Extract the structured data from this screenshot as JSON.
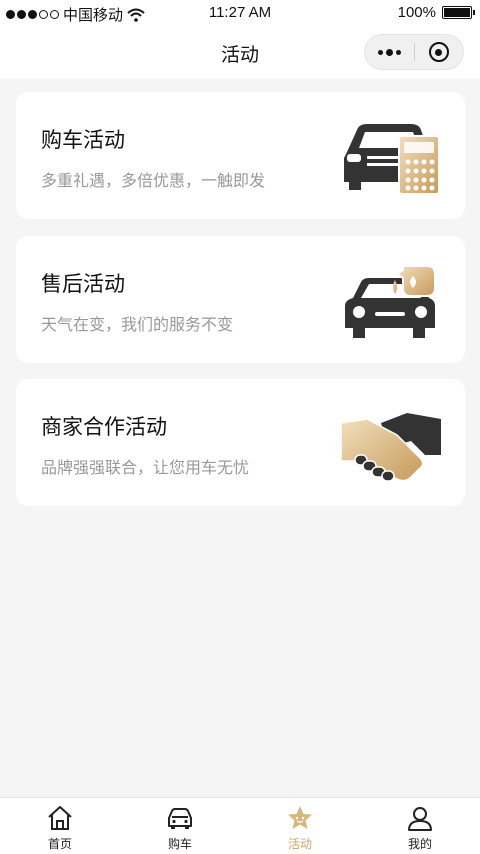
{
  "status_bar": {
    "carrier": "中国移动",
    "time": "11:27 AM",
    "battery": "100%",
    "battery_level": 1.0
  },
  "nav": {
    "title": "活动"
  },
  "cards": [
    {
      "title": "购车活动",
      "subtitle": "多重礼遇，多倍优惠，一触即发",
      "icon": "car-calculator-icon"
    },
    {
      "title": "售后活动",
      "subtitle": "天气在变，我们的服务不变",
      "icon": "car-service-oil-icon"
    },
    {
      "title": "商家合作活动",
      "subtitle": "品牌强强联合，让您用车无忧",
      "icon": "handshake-icon"
    }
  ],
  "tabbar": {
    "items": [
      {
        "label": "首页",
        "icon": "home-icon"
      },
      {
        "label": "购车",
        "icon": "car-icon"
      },
      {
        "label": "活动",
        "icon": "star-icon",
        "active": true
      },
      {
        "label": "我的",
        "icon": "user-icon"
      }
    ]
  },
  "colors": {
    "accent_gold": "#c9a46a",
    "icon_dark": "#333333",
    "background": "#f5f5f5",
    "subtitle_gray": "#999999"
  }
}
